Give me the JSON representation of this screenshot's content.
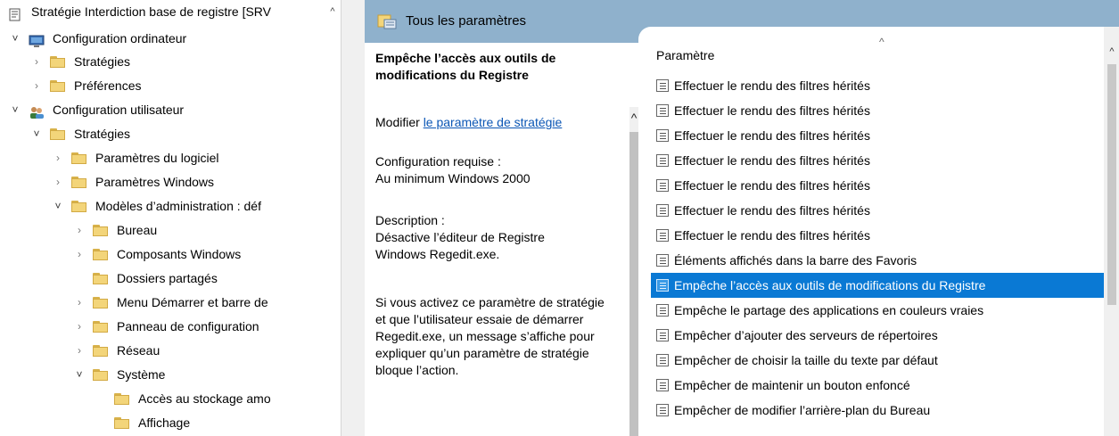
{
  "tree": {
    "scroll_up_glyph": "^",
    "items": [
      {
        "label": "Stratégie Interdiction base de registre [SRV",
        "chevron": "",
        "icon": "policy-document-icon"
      },
      {
        "label": "Configuration ordinateur",
        "chevron": "˅",
        "icon": "computer-icon"
      },
      {
        "label": "Stratégies",
        "chevron": "›",
        "icon": "folder-icon"
      },
      {
        "label": "Préférences",
        "chevron": "›",
        "icon": "folder-icon"
      },
      {
        "label": "Configuration utilisateur",
        "chevron": "˅",
        "icon": "users-icon"
      },
      {
        "label": "Stratégies",
        "chevron": "˅",
        "icon": "folder-icon"
      },
      {
        "label": "Paramètres du logiciel",
        "chevron": "›",
        "icon": "folder-icon"
      },
      {
        "label": "Paramètres Windows",
        "chevron": "›",
        "icon": "folder-icon"
      },
      {
        "label": "Modèles d’administration : déf",
        "chevron": "˅",
        "icon": "folder-icon"
      },
      {
        "label": "Bureau",
        "chevron": "›",
        "icon": "folder-icon"
      },
      {
        "label": "Composants Windows",
        "chevron": "›",
        "icon": "folder-icon"
      },
      {
        "label": "Dossiers partagés",
        "chevron": "",
        "icon": "folder-icon"
      },
      {
        "label": "Menu Démarrer et barre de",
        "chevron": "›",
        "icon": "folder-icon"
      },
      {
        "label": "Panneau de configuration",
        "chevron": "›",
        "icon": "folder-icon"
      },
      {
        "label": "Réseau",
        "chevron": "›",
        "icon": "folder-icon"
      },
      {
        "label": "Système",
        "chevron": "˅",
        "icon": "folder-icon"
      },
      {
        "label": "Accès au stockage amo",
        "chevron": "",
        "icon": "folder-icon"
      },
      {
        "label": "Affichage",
        "chevron": "",
        "icon": "folder-icon"
      }
    ]
  },
  "header": {
    "title": "Tous les paramètres",
    "color": "#8fb1cc"
  },
  "description": {
    "title": "Empêche l’accès aux outils de modifications du Registre",
    "edit_prefix": "Modifier ",
    "edit_link": "le paramètre de stratégie",
    "requirements_label": "Configuration requise :",
    "requirements_value": "Au minimum Windows 2000",
    "description_label": "Description :",
    "description_text": "Désactive l’éditeur de Registre Windows Regedit.exe.",
    "detail_text": "Si vous activez ce paramètre de stratégie et que l’utilisateur essaie de démarrer Regedit.exe, un message s’affiche pour expliquer qu’un paramètre de stratégie bloque l’action.",
    "scroll_up_glyph": "^"
  },
  "settings_list": {
    "column_header": "Paramètre",
    "sort_glyph": "^",
    "scroll_up_glyph": "^",
    "selected_color": "#0a79d4",
    "rows": [
      {
        "label": "Effectuer le rendu des filtres hérités",
        "selected": false
      },
      {
        "label": "Effectuer le rendu des filtres hérités",
        "selected": false
      },
      {
        "label": "Effectuer le rendu des filtres hérités",
        "selected": false
      },
      {
        "label": "Effectuer le rendu des filtres hérités",
        "selected": false
      },
      {
        "label": "Effectuer le rendu des filtres hérités",
        "selected": false
      },
      {
        "label": "Effectuer le rendu des filtres hérités",
        "selected": false
      },
      {
        "label": "Effectuer le rendu des filtres hérités",
        "selected": false
      },
      {
        "label": "Éléments affichés dans la barre des Favoris",
        "selected": false
      },
      {
        "label": "Empêche l’accès aux outils de modifications du Registre",
        "selected": true
      },
      {
        "label": "Empêche le partage des applications en couleurs vraies",
        "selected": false
      },
      {
        "label": "Empêcher d’ajouter des serveurs de répertoires",
        "selected": false
      },
      {
        "label": "Empêcher de choisir la taille du texte par défaut",
        "selected": false
      },
      {
        "label": "Empêcher de maintenir un bouton enfoncé",
        "selected": false
      },
      {
        "label": "Empêcher de modifier l’arrière-plan du Bureau",
        "selected": false
      }
    ]
  }
}
